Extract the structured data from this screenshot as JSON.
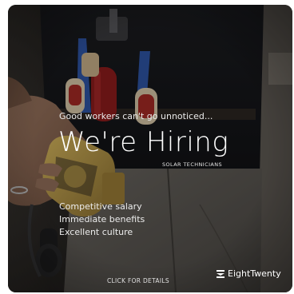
{
  "ad": {
    "tagline": "Good workers can't go unnoticed...",
    "headline": "We're Hiring",
    "subhead": "SOLAR TECHNICIANS",
    "benefits": [
      "Competitive salary",
      "Immediate benefits",
      "Excellent culture"
    ],
    "cta": "CLICK FOR DETAILS",
    "brand": "EightTwenty"
  },
  "icons": {
    "brand_mark": "eighttwenty-logo-icon",
    "photo": "worker-tool-belt-photo"
  },
  "colors": {
    "background": "#24221f",
    "text": "#ffffff",
    "tool_red": "#8e1c1c",
    "tool_yellow": "#c9a44a"
  }
}
